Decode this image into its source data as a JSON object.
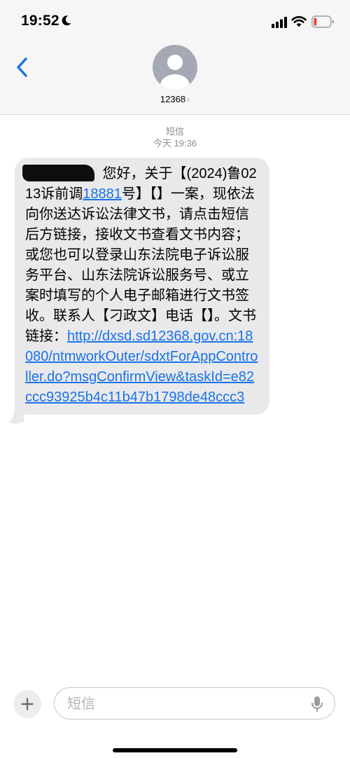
{
  "status_bar": {
    "time": "19:52",
    "icons": [
      "moon-icon",
      "cellular-signal-icon",
      "wifi-icon",
      "battery-low-icon"
    ],
    "battery_color": "#e8453c"
  },
  "header": {
    "contact_name": "12368",
    "back_icon": "chevron-left-icon",
    "accent_color": "#1a73e8"
  },
  "conversation": {
    "service_label": "短信",
    "timestamp": "今天 19:36"
  },
  "message": {
    "text_after_redaction": " 您好，关于【(2024)鲁0213诉前调",
    "case_number_link": "18881",
    "text_main": "号】【】一案，现依法向你送达诉讼法律文书，请点击短信后方链接，接收文书查看文书内容；或您也可以登录山东法院电子诉讼服务平台、山东法院诉讼服务号、或立案时填写的个人电子邮箱进行文书签收。联系人【刁政文】电话【】。文书链接：",
    "url": "http://dxsd.sd12368.gov.cn:18080/ntmworkOuter/sdxtForAppController.do?msgConfirmView&taskId=e82ccc93925b4c11b47b1798de48ccc3"
  },
  "composer": {
    "placeholder": "短信",
    "add_icon": "plus-icon",
    "mic_icon": "microphone-icon"
  }
}
